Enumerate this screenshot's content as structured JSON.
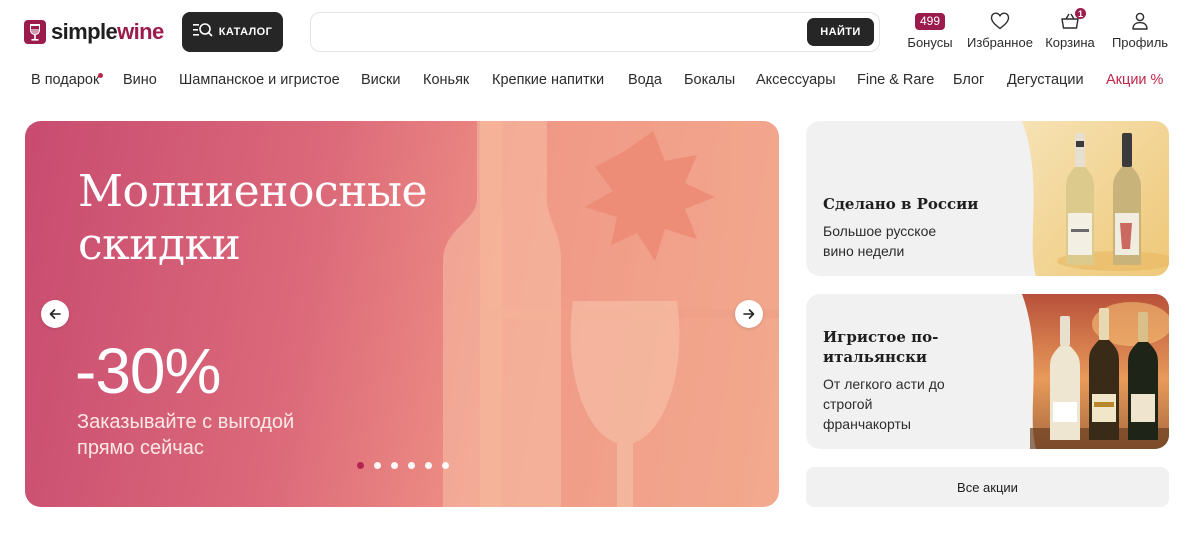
{
  "header": {
    "logo": {
      "part1": "simple",
      "part2": "wine"
    },
    "catalog_label": "КАТАЛОГ",
    "search": {
      "value": "",
      "placeholder": "",
      "button_label": "НАЙТИ"
    },
    "bonus": {
      "count": "499",
      "label": "Бонусы"
    },
    "favorites": {
      "label": "Избранное"
    },
    "cart": {
      "count": "1",
      "label": "Корзина"
    },
    "profile": {
      "label": "Профиль"
    }
  },
  "nav": {
    "items": [
      {
        "label": "В подарок"
      },
      {
        "label": "Вино"
      },
      {
        "label": "Шампанское и игристое"
      },
      {
        "label": "Виски"
      },
      {
        "label": "Коньяк"
      },
      {
        "label": "Крепкие напитки"
      },
      {
        "label": "Вода"
      },
      {
        "label": "Бокалы"
      },
      {
        "label": "Аксессуары"
      },
      {
        "label": "Fine & Rare"
      },
      {
        "label": "Блог"
      },
      {
        "label": "Дегустации"
      },
      {
        "label": "Акции %"
      }
    ]
  },
  "hero": {
    "title_line1": "Молниеносные",
    "title_line2": "скидки",
    "discount": "-30%",
    "subtitle_line1": "Заказывайте с выгодой",
    "subtitle_line2": "прямо сейчас",
    "slides_total": 6,
    "active_slide": 1
  },
  "promos": [
    {
      "title": "Сделано в России",
      "desc_line1": "Большое русское",
      "desc_line2": "вино недели"
    },
    {
      "title_line1": "Игристое по-",
      "title_line2": "итальянски",
      "desc_line1": "От легкого асти до",
      "desc_line2": "строгой",
      "desc_line3": "франчакорты"
    }
  ],
  "all_promos_label": "Все акции",
  "colors": {
    "brand": "#9b1b4c",
    "accent_red": "#c0264a",
    "dark_button": "#262626",
    "card_bg": "#f1f1f1"
  },
  "icons": {
    "catalog": "search-menu-icon",
    "favorites": "heart-icon",
    "cart": "basket-icon",
    "profile": "user-icon",
    "prev": "arrow-left-icon",
    "next": "arrow-right-icon"
  }
}
